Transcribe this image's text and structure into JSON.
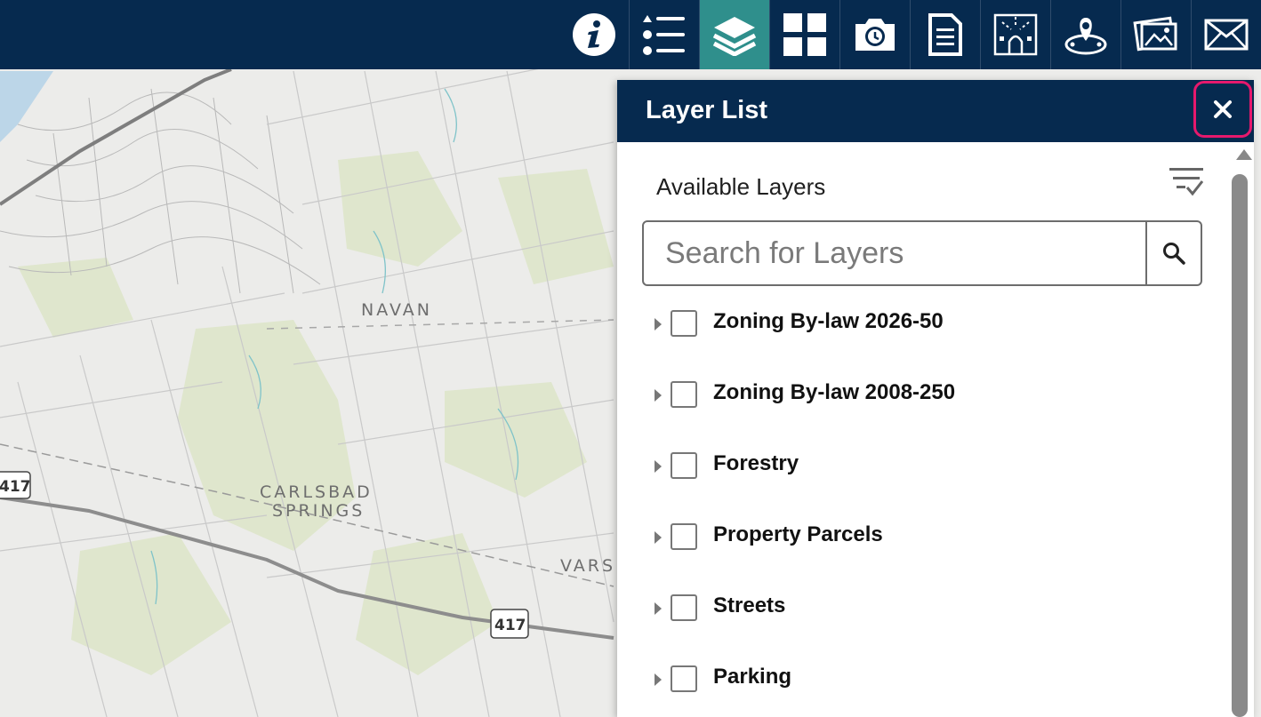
{
  "map": {
    "labels": [
      "NAVAN",
      "CARLSBAD",
      "SPRINGS",
      "VARS"
    ],
    "highway_shields": [
      "417",
      "417"
    ]
  },
  "toolbar": {
    "buttons": [
      {
        "name": "info",
        "icon": "info-icon"
      },
      {
        "name": "legend",
        "icon": "list-icon"
      },
      {
        "name": "layers",
        "icon": "layers-icon",
        "active": true
      },
      {
        "name": "basemap",
        "icon": "grid-icon"
      },
      {
        "name": "snapshot",
        "icon": "camera-clock-icon"
      },
      {
        "name": "report",
        "icon": "document-icon"
      },
      {
        "name": "site-plan",
        "icon": "site-plan-icon"
      },
      {
        "name": "location",
        "icon": "map-pin-icon"
      },
      {
        "name": "gallery",
        "icon": "photos-icon"
      },
      {
        "name": "email",
        "icon": "envelope-icon"
      }
    ],
    "colors": {
      "background": "#062a4f",
      "active": "#2f8f8c"
    }
  },
  "layer_panel": {
    "title": "Layer List",
    "close_icon": "close-icon",
    "available_label": "Available Layers",
    "filter_icon": "filter-check-icon",
    "search": {
      "placeholder": "Search for Layers",
      "value": "",
      "icon": "search-icon"
    },
    "layers": [
      {
        "label": "Zoning By-law 2026-50",
        "checked": false
      },
      {
        "label": "Zoning By-law 2008-250",
        "checked": false
      },
      {
        "label": "Forestry",
        "checked": false
      },
      {
        "label": "Property Parcels",
        "checked": false
      },
      {
        "label": "Streets",
        "checked": false
      },
      {
        "label": "Parking",
        "checked": false
      }
    ],
    "colors": {
      "highlight": "#e6196d"
    }
  }
}
